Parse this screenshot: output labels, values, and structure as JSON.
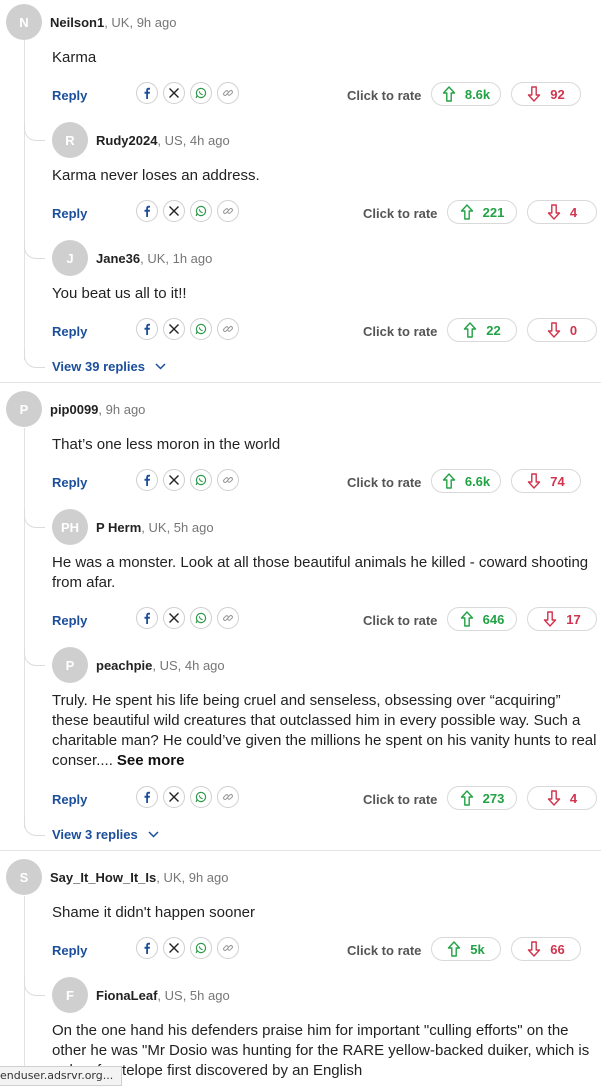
{
  "ui": {
    "reply_label": "Reply",
    "rate_label": "Click to rate",
    "share_icons": [
      "facebook-icon",
      "x-icon",
      "whatsapp-icon",
      "link-icon"
    ]
  },
  "threads": [
    {
      "comment": {
        "initials": "N",
        "user": "Neilson1",
        "info": ", UK, 9h ago",
        "text": "Karma",
        "up": "8.6k",
        "down": "92"
      },
      "replies": [
        {
          "initials": "R",
          "user": "Rudy2024",
          "info": ", US, 4h ago",
          "text": "Karma never loses an address.",
          "up": "221",
          "down": "4"
        },
        {
          "initials": "J",
          "user": "Jane36",
          "info": ", UK, 1h ago",
          "text": "You beat us all to it!!",
          "up": "22",
          "down": "0"
        }
      ],
      "view_replies": "View 39 replies"
    },
    {
      "comment": {
        "initials": "P",
        "user": "pip0099",
        "info": ", 9h ago",
        "text": "That’s one less moron in the world",
        "up": "6.6k",
        "down": "74"
      },
      "replies": [
        {
          "initials": "PH",
          "user": "P Herm",
          "info": ", UK, 5h ago",
          "text": "He was a monster. Look at all those beautiful animals he killed - coward shooting from afar.",
          "up": "646",
          "down": "17"
        },
        {
          "initials": "P",
          "user": "peachpie",
          "info": ", US, 4h ago",
          "text": "Truly. He spent his life being cruel and senseless, obsessing over “acquiring” these beautiful wild creatures that outclassed him in every possible way. Such a charitable man? He could’ve given the millions he spent on his vanity hunts to real conser....",
          "see_more": "See more",
          "up": "273",
          "down": "4"
        }
      ],
      "view_replies": "View 3 replies"
    },
    {
      "comment": {
        "initials": "S",
        "user": "Say_It_How_It_Is",
        "info": ", UK, 9h ago",
        "text": "Shame it didn't happen sooner",
        "up": "5k",
        "down": "66"
      },
      "replies": [
        {
          "initials": "F",
          "user": "FionaLeaf",
          "info": ", US, 5h ago",
          "text": "On the one hand his defenders praise him for important \"culling efforts\" on the other he was \"Mr Dosio was hunting for the RARE yellow-backed duiker, which is a dwarf ... telope first discovered by an English",
          "up": "",
          "down": ""
        }
      ]
    }
  ],
  "status_bar": "enduser.adsrvr.org..."
}
